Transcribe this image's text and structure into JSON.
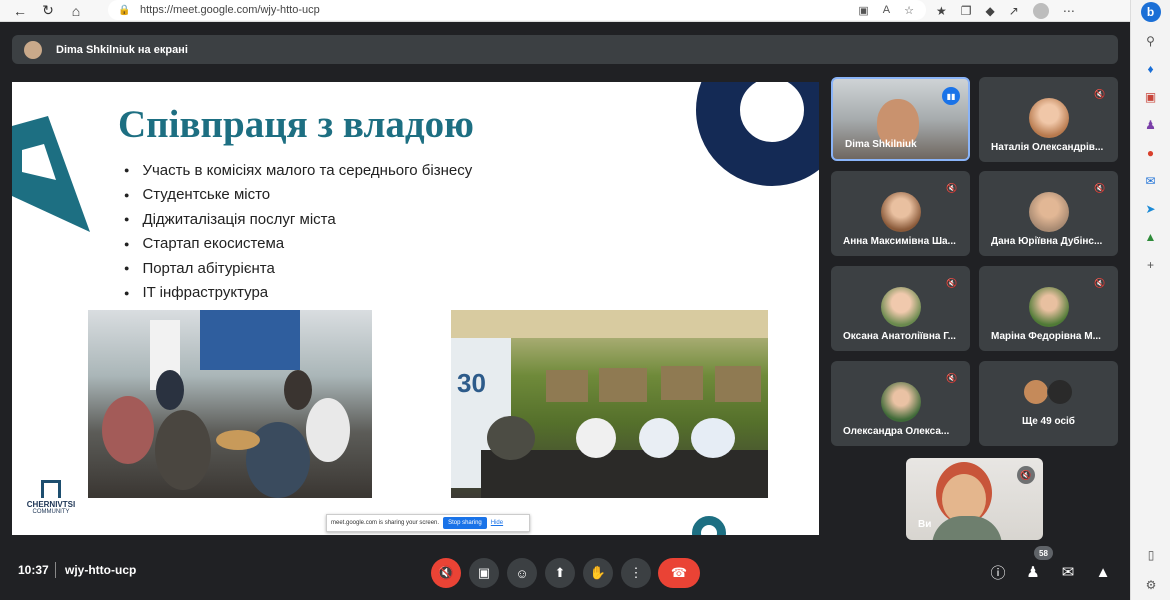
{
  "browser": {
    "url": "https://meet.google.com/wjy-htto-ucp"
  },
  "banner": {
    "text": "Dima Shkilniuk на екрані"
  },
  "slide": {
    "title": "Співпраця з владою",
    "bullets": [
      "Участь в комісіях малого та середнього бізнесу",
      "Студентське місто",
      "Діджиталізація послуг міста",
      "Стартап екосистема",
      "Портал абітурієнта",
      "IT інфраструктура"
    ],
    "logo_text": "CHERNIVTSI",
    "logo_sub": "COMMUNITY",
    "share_notice": "meet.google.com is sharing your screen.",
    "stop_sharing_label": "Stop sharing",
    "hide_label": "Hide"
  },
  "participants": [
    {
      "name": "Dima Shkilniuk",
      "active": true
    },
    {
      "name": "Наталія Олександрів..."
    },
    {
      "name": "Анна Максимівна Ша..."
    },
    {
      "name": "Дана Юріївна Дубінс..."
    },
    {
      "name": "Оксана Анатоліївна Г..."
    },
    {
      "name": "Маріна Федорівна М..."
    },
    {
      "name": "Олександра Олекса..."
    }
  ],
  "more_participants": "Ще 49 осіб",
  "self_label": "Ви",
  "meeting": {
    "time": "10:37",
    "code": "wjy-htto-ucp",
    "participants_count": "58"
  },
  "colors": {
    "accent_red": "#ea4335",
    "slide_title": "#1d6f82",
    "tile_bg": "#3c4043",
    "active_border": "#8ab4f8"
  }
}
